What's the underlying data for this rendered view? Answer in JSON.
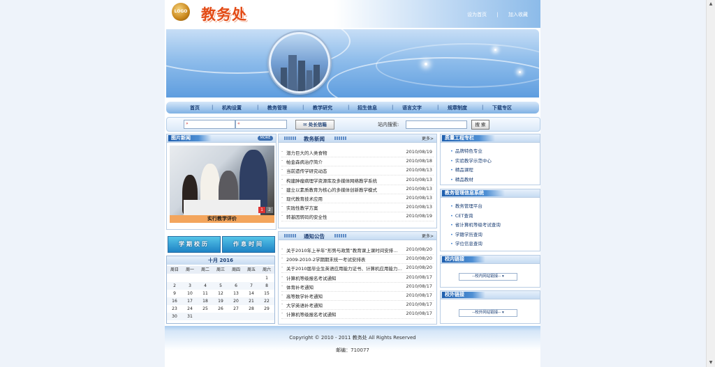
{
  "header": {
    "logo_text": "LOGO",
    "site_title": "教务处",
    "links": [
      "设为首页",
      "|",
      "加入收藏"
    ]
  },
  "nav": {
    "items": [
      "首页",
      "机构设置",
      "教务管理",
      "教学研究",
      "招生信息",
      "语言文字",
      "规章制度",
      "下载专区"
    ]
  },
  "searchbar": {
    "head_button": "处长信箱",
    "label": "站内搜索:",
    "search_button": "搜 索"
  },
  "photo_news": {
    "title": "图片新闻",
    "more": "MORE",
    "caption": "实行教学评价",
    "pages": [
      "1",
      "2"
    ]
  },
  "quick_buttons": [
    "学期校历",
    "作息时间"
  ],
  "calendar": {
    "title": "十月 2016",
    "weekdays": [
      "周日",
      "周一",
      "周二",
      "周三",
      "周四",
      "周五",
      "周六"
    ],
    "weeks": [
      [
        "",
        "",
        "",
        "",
        "",
        "",
        "1"
      ],
      [
        "2",
        "3",
        "4",
        "5",
        "6",
        "7",
        "8"
      ],
      [
        "9",
        "10",
        "11",
        "12",
        "13",
        "14",
        "15"
      ],
      [
        "16",
        "17",
        "18",
        "19",
        "20",
        "21",
        "22"
      ],
      [
        "23",
        "24",
        "25",
        "26",
        "27",
        "28",
        "29"
      ],
      [
        "30",
        "31",
        "",
        "",
        "",
        "",
        ""
      ]
    ]
  },
  "edu_news": {
    "title": "教务新闻",
    "more": "更多>",
    "items": [
      {
        "title": "潜力巨大的人类食物",
        "date": "2010/08/19"
      },
      {
        "title": "帕金森病治疗简介",
        "date": "2010/08/18"
      },
      {
        "title": "当前遗传学研究动态",
        "date": "2010/08/13"
      },
      {
        "title": "构建肿瘤病理学资源库及多媒体网络教学系统",
        "date": "2010/08/13"
      },
      {
        "title": "建立以素质教育为核心的多媒体创新教学模式",
        "date": "2010/08/13"
      },
      {
        "title": "现代教育技术应用",
        "date": "2010/08/13"
      },
      {
        "title": "实践性教学方案",
        "date": "2010/08/13"
      },
      {
        "title": "转基因转码的安全性",
        "date": "2010/08/19"
      }
    ]
  },
  "notices": {
    "title": "通知公告",
    "more": "更多>",
    "items": [
      {
        "title": "关于2010年上半年“形势与政策”教育课上课时间安排…",
        "date": "2010/08/20"
      },
      {
        "title": "2009-2010-2学期期末统一考试安排表",
        "date": "2010/08/20"
      },
      {
        "title": "关于2010届毕业生英语应用能力证书、计算机应用能力…",
        "date": "2010/08/20"
      },
      {
        "title": "计算机等级报名考试通知",
        "date": "2010/08/17"
      },
      {
        "title": "体育补考通知",
        "date": "2010/08/17"
      },
      {
        "title": "高等数学补考通知",
        "date": "2010/08/17"
      },
      {
        "title": "大学英语补考通知",
        "date": "2010/08/17"
      },
      {
        "title": "计算机等级报名考试通知",
        "date": "2010/08/17"
      }
    ]
  },
  "quality_project": {
    "title": "质量工程专栏",
    "items": [
      "品牌特色专业",
      "实验教学示范中心",
      "精品课程",
      "精品教材"
    ]
  },
  "mgmt_system": {
    "title": "教务管理信息系统",
    "items": [
      "教务管理平台",
      "CET查询",
      "省计算机等级考试查询",
      "学籍学历查询",
      "学位信息查询"
    ]
  },
  "intra_links": {
    "title": "校内链接",
    "select": "--校内网站链接--"
  },
  "extra_links": {
    "title": "校外链接",
    "select": "--校外网站链接--"
  },
  "footer": {
    "copyright": "Copyright © 2010 - 2011 教务处  All Rights Reserved",
    "postcode": "邮编：710077"
  }
}
